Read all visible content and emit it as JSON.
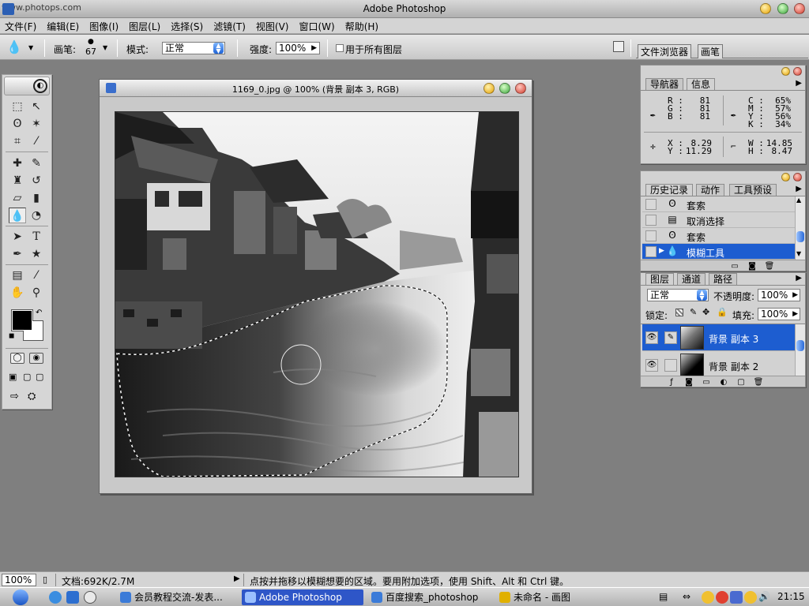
{
  "window": {
    "watermark": "www.photops.com",
    "title": "Adobe Photoshop"
  },
  "menu": [
    "文件(F)",
    "编辑(E)",
    "图像(I)",
    "图层(L)",
    "选择(S)",
    "滤镜(T)",
    "视图(V)",
    "窗口(W)",
    "帮助(H)"
  ],
  "options": {
    "brush_label": "画笔:",
    "brush_size": "67",
    "mode_label": "模式:",
    "mode_value": "正常",
    "strength_label": "强度:",
    "strength_value": "100%",
    "all_layers_label": "用于所有图层",
    "tab_file_browser": "文件浏览器",
    "tab_brushes": "画笔"
  },
  "document": {
    "title": "1169_0.jpg @ 100% (背景 副本 3, RGB)"
  },
  "navigator": {
    "tab_nav": "导航器",
    "tab_info": "信息",
    "rgb": {
      "R": "81",
      "G": "81",
      "B": "81"
    },
    "cmyk": {
      "C": "65%",
      "M": "57%",
      "Y": "56%",
      "K": "34%"
    },
    "xy": {
      "X": "8.29",
      "Y": "11.29"
    },
    "wh": {
      "W": "14.85",
      "H": "8.47"
    }
  },
  "history": {
    "tabs": [
      "历史记录",
      "动作",
      "工具预设"
    ],
    "items": [
      {
        "label": "套索",
        "icon": "lasso-icon",
        "selected": false
      },
      {
        "label": "取消选择",
        "icon": "document-icon",
        "selected": false
      },
      {
        "label": "套索",
        "icon": "lasso-icon",
        "selected": false
      },
      {
        "label": "模糊工具",
        "icon": "blur-drop-icon",
        "selected": true
      }
    ]
  },
  "layers": {
    "tabs": [
      "图层",
      "通道",
      "路径"
    ],
    "blend_mode": "正常",
    "opacity_label": "不透明度:",
    "opacity_value": "100%",
    "lock_label": "锁定:",
    "fill_label": "填充:",
    "fill_value": "100%",
    "items": [
      {
        "name": "背景 副本 3",
        "selected": true
      },
      {
        "name": "背景 副本 2",
        "selected": false
      }
    ]
  },
  "status": {
    "zoom": "100%",
    "doc": "文档:692K/2.7M",
    "hint": "点按并拖移以模糊想要的区域。要用附加选项，使用 Shift、Alt 和 Ctrl 键。"
  },
  "taskbar": {
    "items": [
      {
        "label": "会员教程交流-发表...",
        "active": false
      },
      {
        "label": "Adobe Photoshop",
        "active": true
      },
      {
        "label": "百度搜索_photoshop ...",
        "active": false
      },
      {
        "label": "未命名 - 画图",
        "active": false
      }
    ],
    "clock": "21:15"
  },
  "colors": {
    "accent": "#1d5dd0",
    "task_active": "#2e56c8"
  }
}
